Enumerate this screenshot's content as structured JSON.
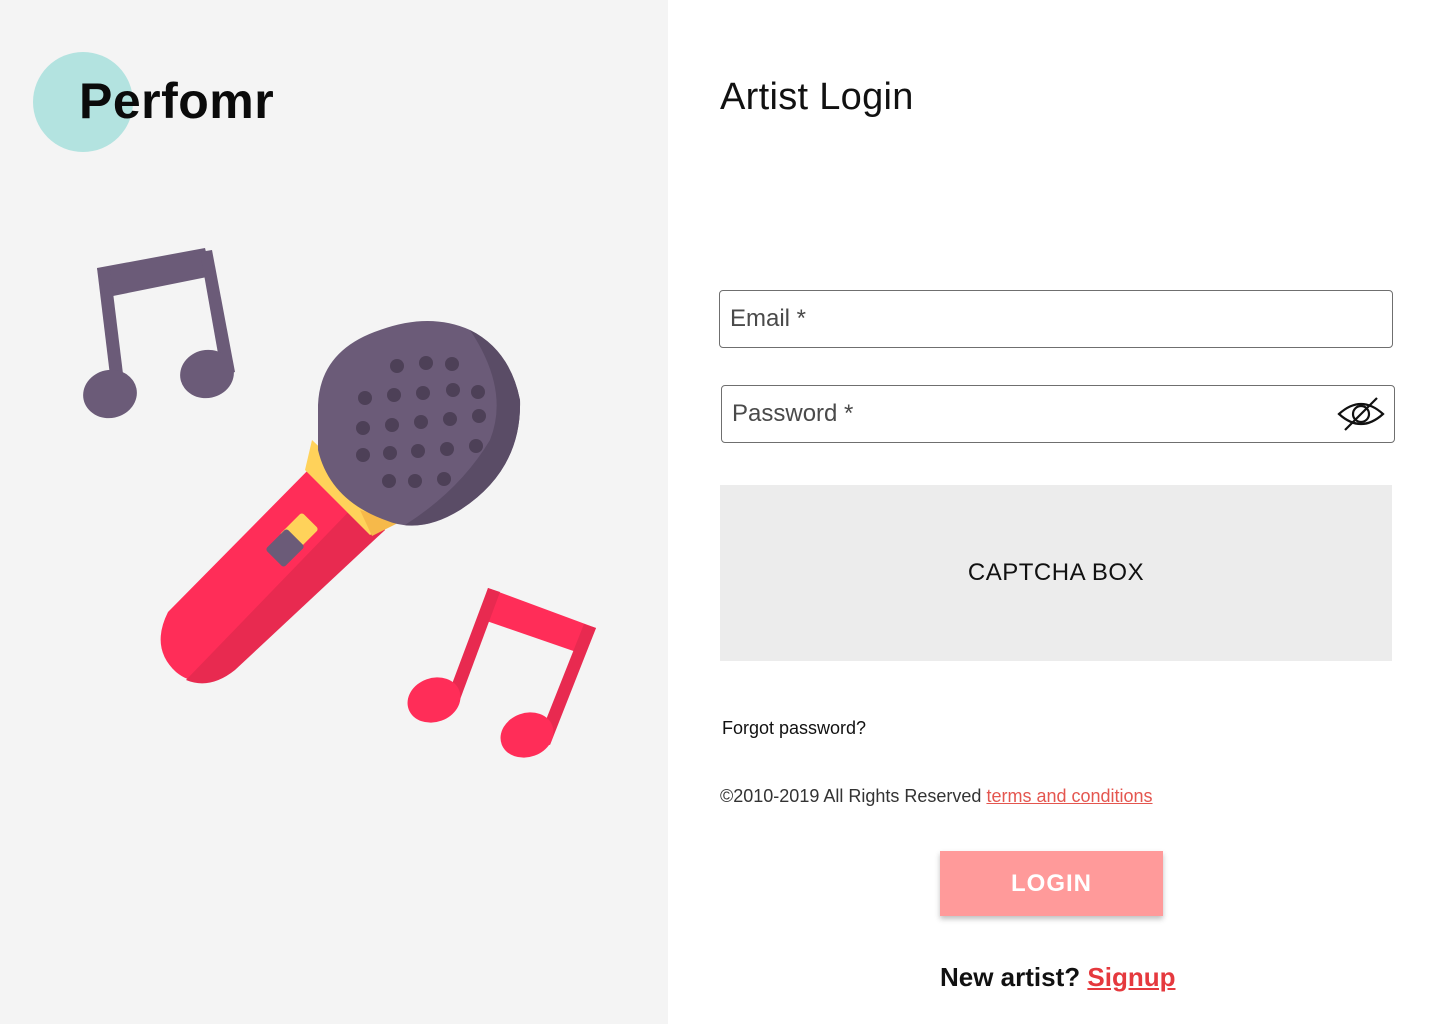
{
  "brand": {
    "name": "Perfomr",
    "circle_color": "#b3e3e0"
  },
  "illustration": {
    "icons": [
      "music-note-icon",
      "microphone-icon",
      "music-note-icon"
    ],
    "colors": {
      "dark_purple": "#6b5b78",
      "pink": "#ff2d58",
      "yellow": "#ffd25a"
    }
  },
  "login": {
    "title": "Artist Login",
    "email_placeholder": "Email *",
    "password_placeholder": "Password *",
    "password_toggle_icon": "eye-off-icon",
    "captcha_label": "CAPTCHA BOX",
    "forgot_password": "Forgot password?",
    "copyright": "©2010-2019 All Rights Reserved",
    "terms_link": "terms and conditions",
    "login_button": "LOGIN",
    "new_artist": "New artist?",
    "signup_link": "Signup"
  },
  "colors": {
    "left_panel_bg": "#f4f4f4",
    "captcha_bg": "#ececec",
    "login_button_bg": "#ff9a9a",
    "link_red": "#e5393e"
  }
}
